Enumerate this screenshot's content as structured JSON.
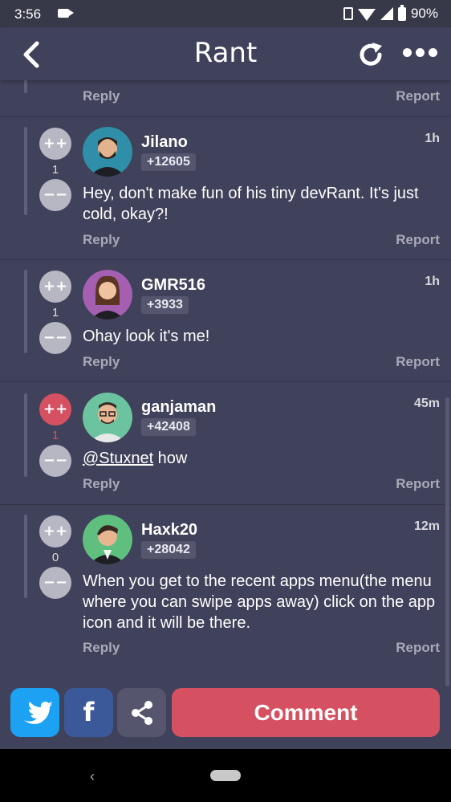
{
  "status_bar": {
    "time": "3:56",
    "battery": "90%"
  },
  "header": {
    "title": "Rant"
  },
  "top_partial": {
    "reply": "Reply",
    "report": "Report"
  },
  "comments": [
    {
      "username": "Jilano",
      "rep": "+12605",
      "age": "1h",
      "score": "1",
      "body": "Hey, don't make fun of his tiny devRant. It's just cold, okay?!",
      "reply": "Reply",
      "report": "Report",
      "avatar_color": "#2f8fa8"
    },
    {
      "username": "GMR516",
      "rep": "+3933",
      "age": "1h",
      "score": "1",
      "body": "Ohay look it's me!",
      "reply": "Reply",
      "report": "Report",
      "avatar_color": "#a45fb0"
    },
    {
      "username": "ganjaman",
      "rep": "+42408",
      "age": "45m",
      "score": "1",
      "mention": "@Stuxnet",
      "body": " how",
      "reply": "Reply",
      "report": "Report",
      "avatar_color": "#6cc3a0",
      "upvoted": true
    },
    {
      "username": "Haxk20",
      "rep": "+28042",
      "age": "12m",
      "score": "0",
      "body": "When you get to the recent apps menu(the menu where you can swipe apps away) click on the app icon and it will be there.",
      "reply": "Reply",
      "report": "Report",
      "avatar_color": "#5fbf7f"
    }
  ],
  "vote": {
    "up": "++",
    "down": "−−"
  },
  "actions": {
    "facebook": "f",
    "comment": "Comment"
  },
  "colors": {
    "background": "#40415a",
    "accent": "#d55161",
    "twitter": "#1da1f2",
    "facebook": "#3b5998"
  }
}
